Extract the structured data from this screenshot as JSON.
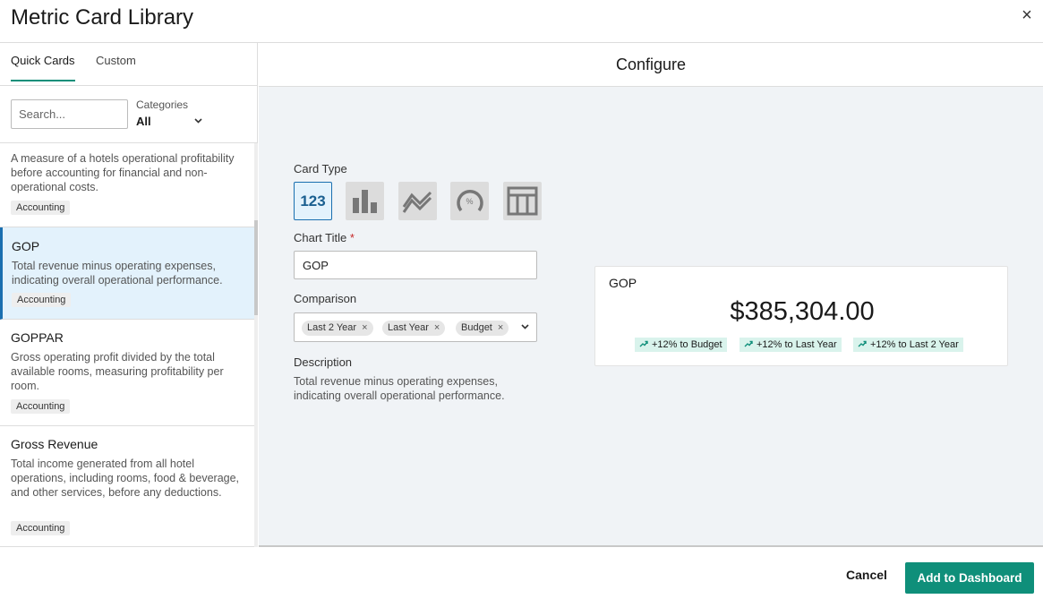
{
  "modal": {
    "title": "Metric Card Library",
    "close_icon": "×"
  },
  "tabs": [
    {
      "label": "Quick Cards"
    },
    {
      "label": "Custom"
    }
  ],
  "search": {
    "placeholder": "Search...",
    "value": ""
  },
  "categories": {
    "label": "Categories",
    "value": "All"
  },
  "list": {
    "items": [
      {
        "title": "",
        "description": "A measure of a hotels operational profitability before accounting for financial and non-operational costs.",
        "badge": "Accounting"
      },
      {
        "title": "GOP",
        "description": "Total revenue minus operating expenses, indicating overall operational performance.",
        "badge": "Accounting"
      },
      {
        "title": "GOPPAR",
        "description": "Gross operating profit divided by the total available rooms, measuring profitability per room.",
        "badge": "Accounting"
      },
      {
        "title": "Gross Revenue",
        "description": "Total income generated from all hotel operations, including rooms, food & beverage, and other services, before any deductions.",
        "badge": "Accounting"
      }
    ]
  },
  "configure": {
    "title": "Configure",
    "card_type_label": "Card Type",
    "card_types": [
      {
        "name": "number",
        "glyph": "123"
      },
      {
        "name": "bar-chart"
      },
      {
        "name": "line-chart"
      },
      {
        "name": "gauge",
        "glyph": "%"
      },
      {
        "name": "table"
      }
    ],
    "chart_title_label": "Chart Title",
    "required_mark": "*",
    "chart_title_value": "GOP",
    "comparison_label": "Comparison",
    "comparison_chips": [
      {
        "label": "Last 2 Year"
      },
      {
        "label": "Last Year"
      },
      {
        "label": "Budget"
      }
    ],
    "chip_remove": "×",
    "description_label": "Description",
    "description_text": "Total revenue minus operating expenses, indicating overall operational performance."
  },
  "preview": {
    "title": "GOP",
    "value": "$385,304.00",
    "trends": [
      {
        "label": "+12% to Budget"
      },
      {
        "label": "+12% to Last Year"
      },
      {
        "label": "+12% to Last 2 Year"
      }
    ]
  },
  "footer": {
    "cancel": "Cancel",
    "add": "Add to Dashboard"
  },
  "colors": {
    "accent": "#0f8f7a",
    "selected_bg": "#e3f2fc",
    "selected_border": "#1a6fb0",
    "trend_bg": "#d9f3ec"
  }
}
